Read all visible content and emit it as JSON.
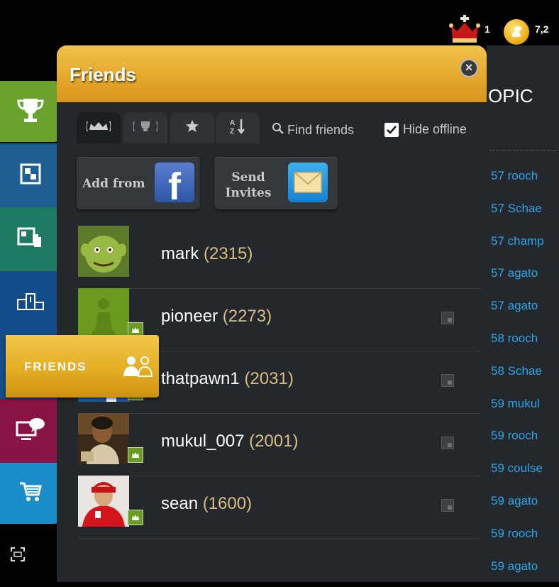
{
  "topbar": {
    "crown_count": "1",
    "coins": "7,2"
  },
  "background": {
    "topic_fragment": "OPIC",
    "rows": [
      "57 rooch",
      "57 Schae",
      "57 champ",
      "57 agato",
      "57 agato",
      "58 rooch",
      "58 Schae",
      "59 mukul",
      "59 rooch",
      "59 coulse",
      "59 agato",
      "59 rooch",
      "59 agato"
    ]
  },
  "nav": {
    "friends_label": "FRIENDS"
  },
  "panel": {
    "title": "Friends",
    "find_friends": "Find friends",
    "hide_offline": "Hide offline",
    "add_from": "Add from",
    "send_invites": "Send Invites"
  },
  "friends": [
    {
      "name": "mark",
      "rating": "(2315)"
    },
    {
      "name": "pioneer",
      "rating": "(2273)"
    },
    {
      "name": "thatpawn1",
      "rating": "(2031)"
    },
    {
      "name": "mukul_007",
      "rating": "(2001)"
    },
    {
      "name": "sean",
      "rating": "(1600)"
    }
  ],
  "colors": {
    "accent_gold": "#e3a62a",
    "panel_bg": "#24272b",
    "rating": "#d9be84",
    "link_blue": "#2aa6e8"
  }
}
